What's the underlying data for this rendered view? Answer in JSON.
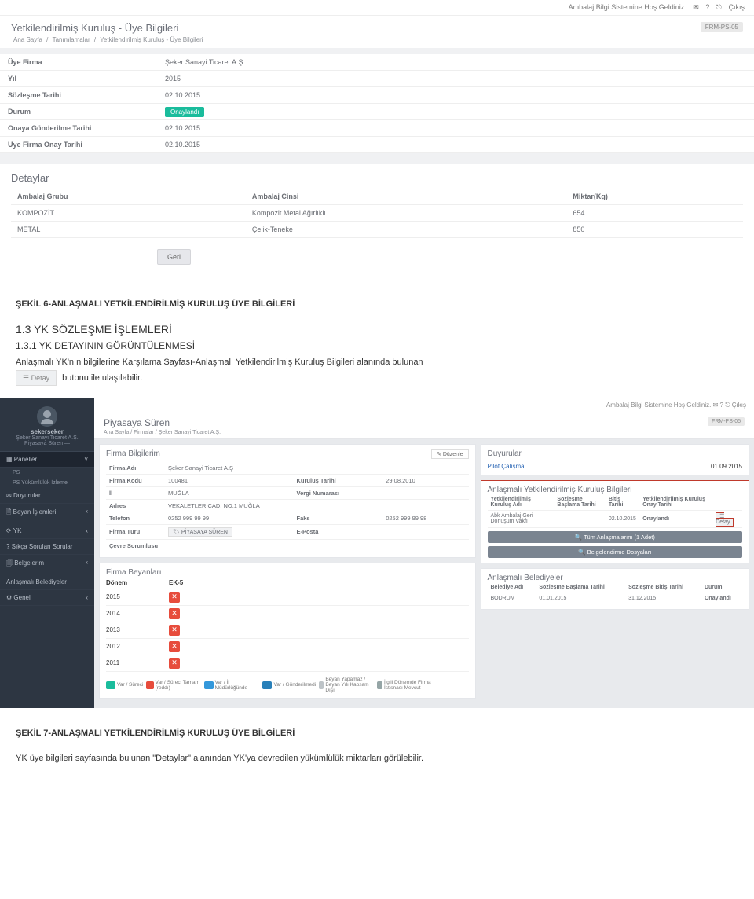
{
  "ss1": {
    "topbar": {
      "welcome": "Ambalaj Bilgi Sistemine Hoş Geldiniz.",
      "help": "?",
      "logout": "Çıkış"
    },
    "title": "Yetkilendirilmiş Kuruluş - Üye Bilgileri",
    "breadcrumb": {
      "a": "Ana Sayfa",
      "b": "Tanımlamalar",
      "c": "Yetkilendirilmiş Kuruluş - Üye Bilgileri"
    },
    "pagekey": "FRM-PS-05",
    "info": {
      "uye_firma_lbl": "Üye Firma",
      "uye_firma": "Şeker Sanayi Ticaret A.Ş.",
      "yil_lbl": "Yıl",
      "yil": "2015",
      "sozlesme_lbl": "Sözleşme Tarihi",
      "sozlesme": "02.10.2015",
      "durum_lbl": "Durum",
      "durum": "Onaylandı",
      "onay_gonder_lbl": "Onaya Gönderilme Tarihi",
      "onay_gonder": "02.10.2015",
      "uye_onay_lbl": "Üye Firma Onay Tarihi",
      "uye_onay": "02.10.2015"
    },
    "details": {
      "title": "Detaylar",
      "col_grup": "Ambalaj Grubu",
      "col_cins": "Ambalaj Cinsi",
      "col_miktar": "Miktar(Kg)",
      "rows": [
        {
          "grup": "KOMPOZİT",
          "cins": "Kompozit Metal Ağırlıklı",
          "miktar": "654"
        },
        {
          "grup": "METAL",
          "cins": "Çelik-Teneke",
          "miktar": "850"
        }
      ]
    },
    "geri": "Geri"
  },
  "doc": {
    "caption6": "ŞEKİL 6-ANLAŞMALI YETKİLENDİRİLMİŞ KURULUŞ ÜYE BİLGİLERİ",
    "h13": "1.3   YK SÖZLEŞME İŞLEMLERİ",
    "h131": "1.3.1   YK DETAYININ GÖRÜNTÜLENMESİ",
    "p1a": "Anlaşmalı YK'nın bilgilerine Karşılama Sayfası-Anlaşmalı Yetkilendirilmiş Kuruluş Bilgileri alanında bulunan",
    "detay_btn": "Detay",
    "p1b": "butonu ile ulaşılabilir.",
    "caption7": "ŞEKİL 7-ANLAŞMALI YETKİLENDİRİLMİŞ KURULUŞ ÜYE BİLGİLERİ",
    "p2": "YK üye bilgileri sayfasında bulunan \"Detaylar\" alanından YK'ya devredilen yükümlülük miktarları görülebilir."
  },
  "ss2": {
    "topbar": {
      "welcome": "Ambalaj Bilgi Sistemine Hoş Geldiniz.",
      "help": "?",
      "logout": "Çıkış"
    },
    "side": {
      "uname": "sekerseker",
      "ucomp": "Şeker Sanayi Ticaret A.Ş.",
      "urole": "Piyasaya Süren —",
      "paneller": "Paneller",
      "ps": "PS",
      "psyuk": "PS Yükümlülük İzleme",
      "duyurular": "Duyurular",
      "beyan": "Beyan İşlemleri",
      "yk": "YK",
      "sss": "Sıkça Sorulan Sorular",
      "belgelerim": "Belgelerim",
      "anl_bel": "Anlaşmalı Belediyeler",
      "genel": "Genel"
    },
    "page": {
      "title": "Piyasaya Süren",
      "bc_a": "Ana Sayfa",
      "bc_b": "Firmalar",
      "bc_c": "Şeker Sanayi Ticaret A.Ş.",
      "key": "FRM-PS-05"
    },
    "firma": {
      "title": "Firma Bilgilerim",
      "edit": "Düzenle",
      "adi_l": "Firma Adı",
      "adi": "Şeker Sanayi Ticaret A.Ş",
      "kodu_l": "Firma Kodu",
      "kodu": "100481",
      "kurulus_l": "Kuruluş Tarihi",
      "kurulus": "29.08.2010",
      "il_l": "İl",
      "il": "MUĞLA",
      "vergi_l": "Vergi Numarası",
      "vergi": "",
      "adres_l": "Adres",
      "adres": "VEKALETLER CAD. NO:1 MUĞLA",
      "tel_l": "Telefon",
      "tel": "0252 999 99 99",
      "faks_l": "Faks",
      "faks": "0252 999 99 98",
      "turu_l": "Firma Türü",
      "turu": "PİYASAYA SÜREN",
      "eposta_l": "E-Posta",
      "eposta": "",
      "cevre_l": "Çevre Sorumlusu"
    },
    "beyanlar": {
      "title": "Firma Beyanları",
      "col_donem": "Dönem",
      "col_eks": "EK-5",
      "yrs": [
        "2015",
        "2014",
        "2013",
        "2012",
        "2011"
      ],
      "legend": [
        {
          "c": "#1abc9c",
          "t": "Var / Süreci"
        },
        {
          "c": "#e74c3c",
          "t": "Var / Süreci Tamam (reddı)"
        },
        {
          "c": "#3498db",
          "t": "Var / İl Müdürlüğünde"
        },
        {
          "c": "#2980b9",
          "t": "Var / Gönderilmedi"
        },
        {
          "c": "#bdc3c7",
          "t": "Beyan Yapamaz / Beyan Yılı Kapsam Dışı"
        },
        {
          "c": "#95a5a6",
          "t": "İlgili Dönemde Firma İstisnası Mevcut"
        }
      ]
    },
    "duyuru": {
      "title": "Duyurular",
      "pilot": "Pilot Çalışma",
      "dt": "01.09.2015"
    },
    "yk": {
      "title": "Anlaşmalı Yetkilendirilmiş Kuruluş Bilgileri",
      "c1": "Yetkilendirilmiş Kuruluş Adı",
      "c2": "Sözleşme Başlama Tarihi",
      "c3": "Bitiş Tarihi",
      "c4": "Yetkilendirilmiş Kuruluş Onay Tarihi",
      "r_name": "Abk Ambalaj Geri Dönüşüm Vakfı",
      "r_dt": "02.10.2015",
      "r_status": "Onaylandı",
      "r_detay": "Detay",
      "bar1": "Tüm Anlaşmalarım (1 Adet)",
      "bar2": "Belgelendirme Dosyaları"
    },
    "bel": {
      "title": "Anlaşmalı Belediyeler",
      "c1": "Belediye Adı",
      "c2": "Sözleşme Başlama Tarihi",
      "c3": "Sözleşme Bitiş Tarihi",
      "c4": "Durum",
      "name": "BODRUM",
      "d1": "01.01.2015",
      "d2": "31.12.2015",
      "st": "Onaylandı"
    }
  }
}
